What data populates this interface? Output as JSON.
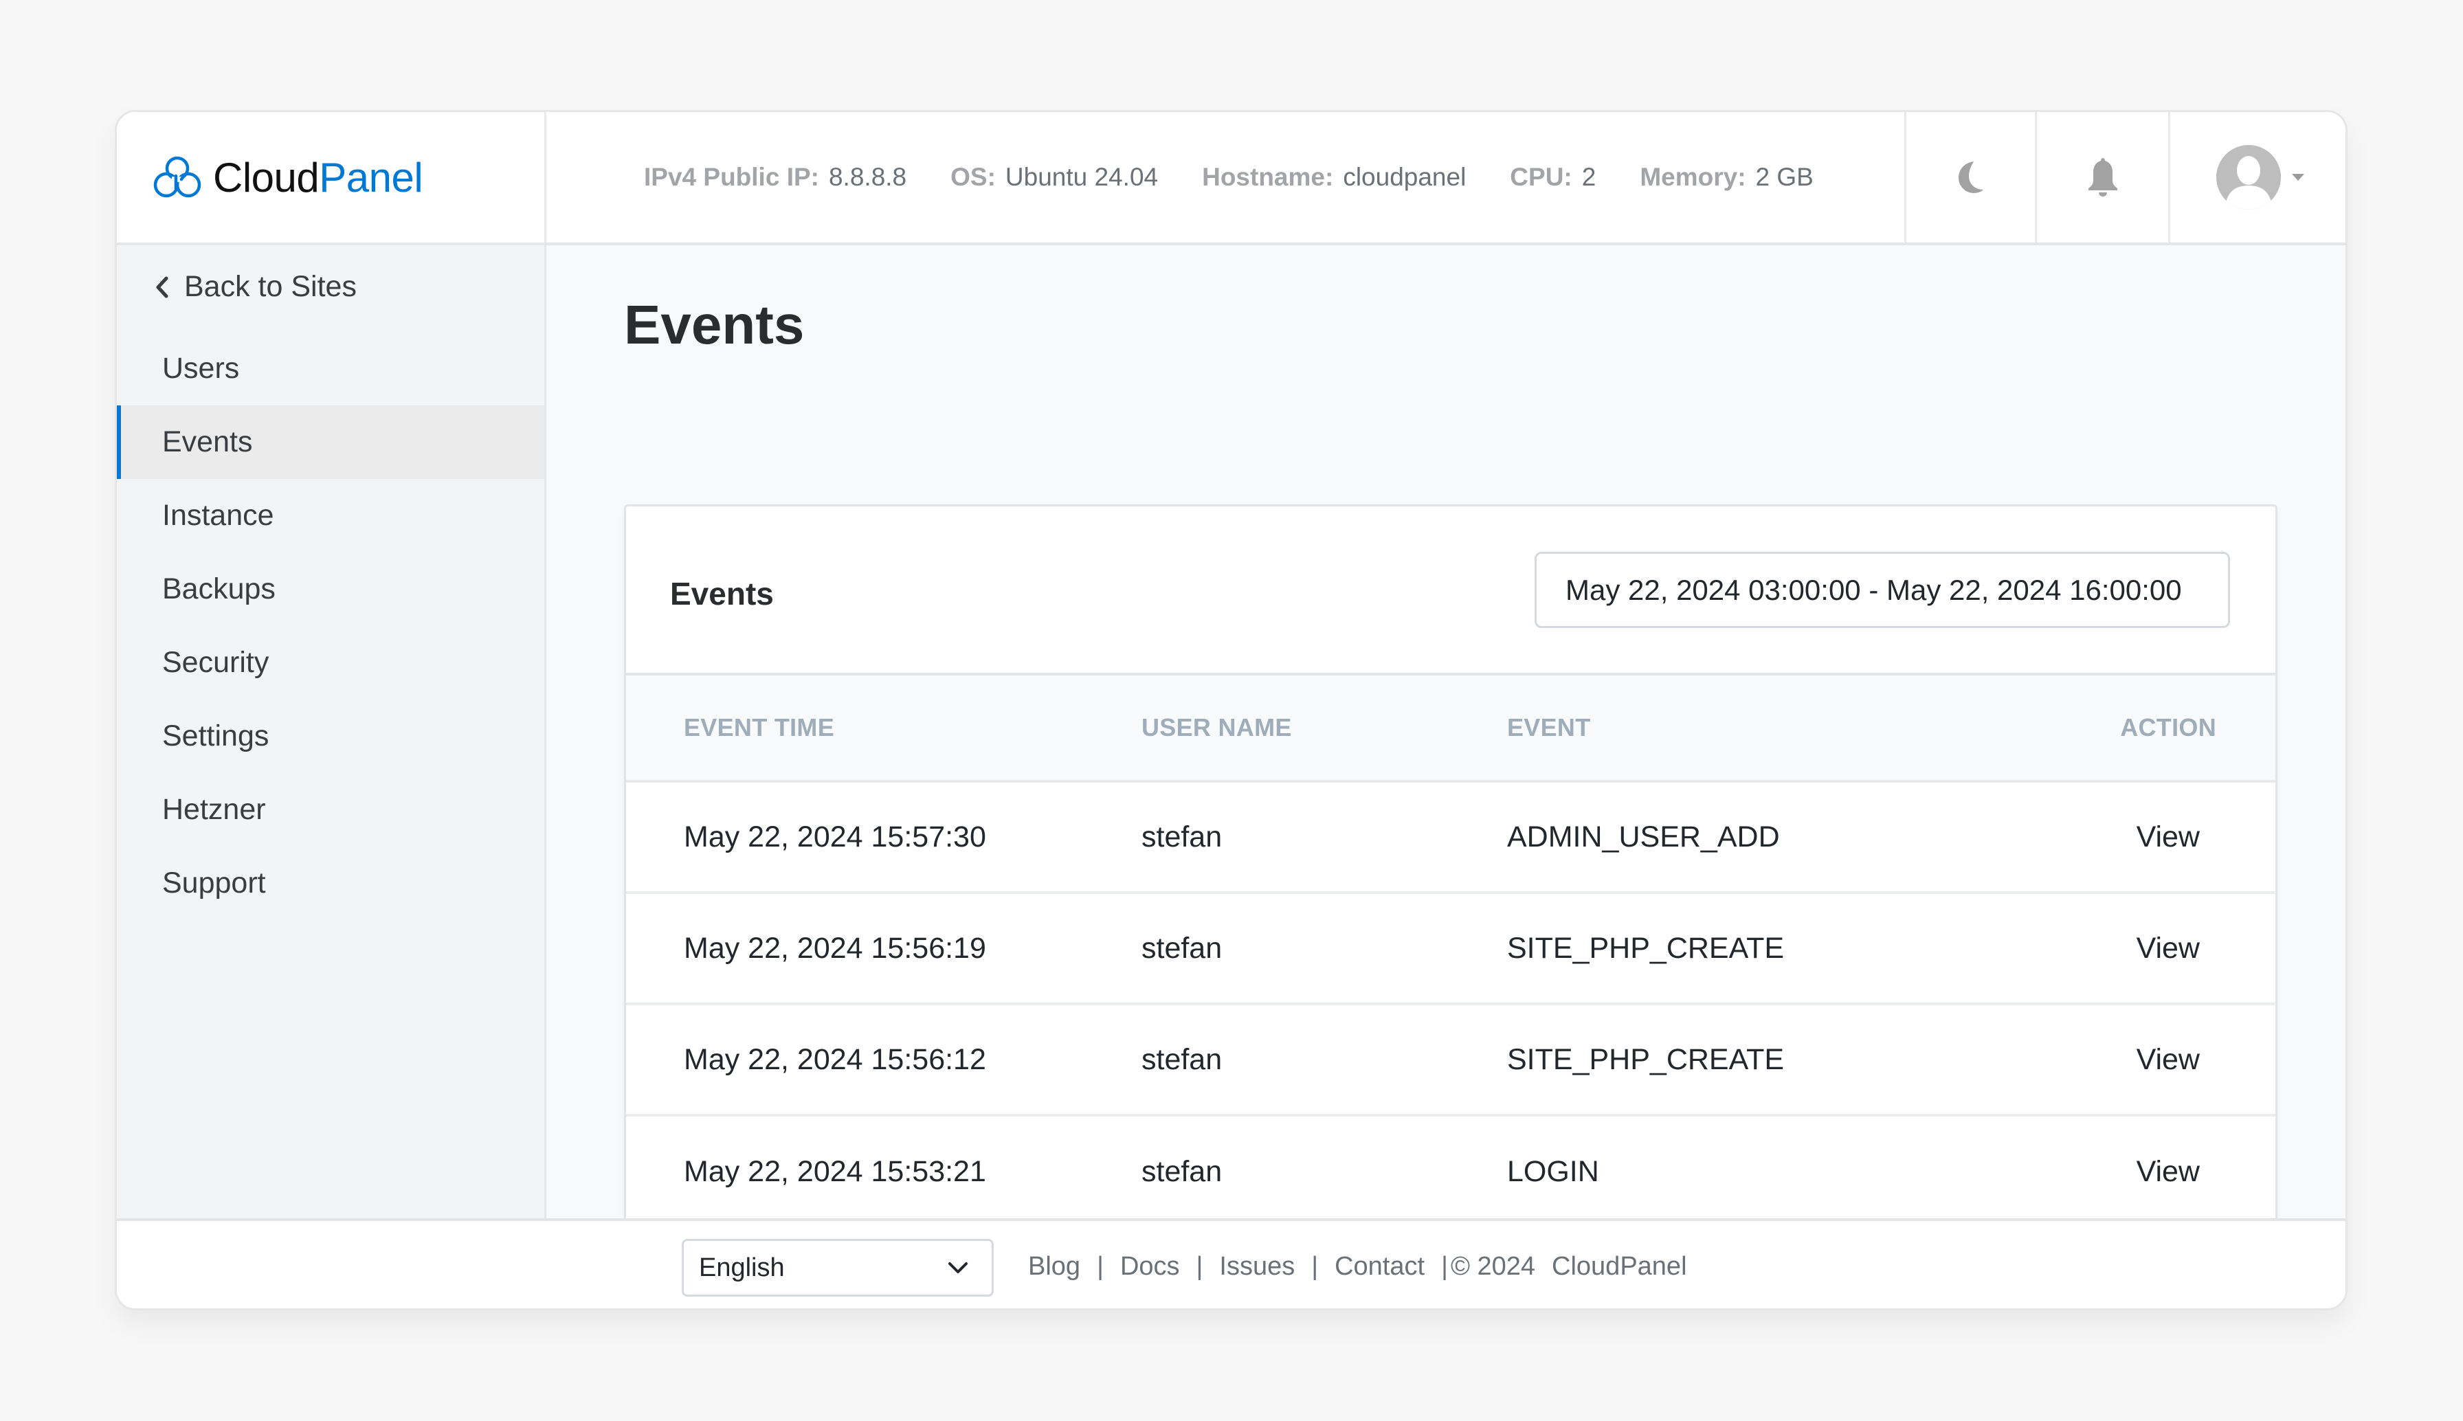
{
  "app": {
    "brand_part1": "Cloud",
    "brand_part2": "Panel",
    "accent_color": "#0078d6"
  },
  "header": {
    "server_info": [
      {
        "label": "IPv4 Public IP:",
        "value": "8.8.8.8"
      },
      {
        "label": "OS:",
        "value": "Ubuntu 24.04"
      },
      {
        "label": "Hostname:",
        "value": "cloudpanel"
      },
      {
        "label": "CPU:",
        "value": "2"
      },
      {
        "label": "Memory:",
        "value": "2 GB"
      }
    ],
    "icons": {
      "theme_toggle": "moon-icon",
      "notifications": "bell-icon",
      "user_menu": "avatar-icon",
      "user_menu_caret": "caret-down-icon"
    }
  },
  "sidebar": {
    "back_label": "Back to Sites",
    "items": [
      {
        "label": "Users",
        "active": false
      },
      {
        "label": "Events",
        "active": true
      },
      {
        "label": "Instance",
        "active": false
      },
      {
        "label": "Backups",
        "active": false
      },
      {
        "label": "Security",
        "active": false
      },
      {
        "label": "Settings",
        "active": false
      },
      {
        "label": "Hetzner",
        "active": false
      },
      {
        "label": "Support",
        "active": false
      }
    ]
  },
  "main": {
    "page_title": "Events",
    "card": {
      "title": "Events",
      "date_range": "May 22, 2024 03:00:00 - May 22, 2024 16:00:00",
      "table": {
        "columns": [
          "EVENT TIME",
          "USER NAME",
          "EVENT",
          "ACTION"
        ],
        "rows": [
          {
            "time": "May 22, 2024 15:57:30",
            "user": "stefan",
            "event": "ADMIN_USER_ADD",
            "action": "View"
          },
          {
            "time": "May 22, 2024 15:56:19",
            "user": "stefan",
            "event": "SITE_PHP_CREATE",
            "action": "View"
          },
          {
            "time": "May 22, 2024 15:56:12",
            "user": "stefan",
            "event": "SITE_PHP_CREATE",
            "action": "View"
          },
          {
            "time": "May 22, 2024 15:53:21",
            "user": "stefan",
            "event": "LOGIN",
            "action": "View"
          }
        ]
      }
    }
  },
  "footer": {
    "language": "English",
    "links": [
      "Blog",
      "Docs",
      "Issues",
      "Contact"
    ],
    "copyright": "© 2024",
    "brand": "CloudPanel"
  }
}
